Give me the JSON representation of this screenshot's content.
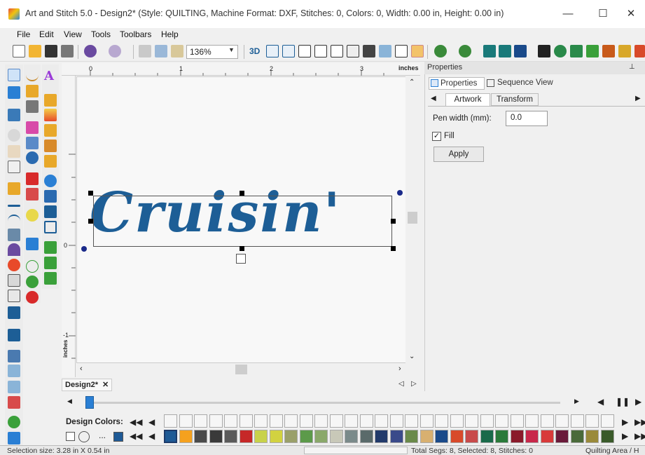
{
  "window": {
    "title": "Art and Stitch 5.0 - Design2* (Style: QUILTING, Machine Format: DXF, Stitches: 0, Colors: 0, Width: 0.00 in, Height: 0.00 in)",
    "minimize": "—",
    "maximize": "☐",
    "close": "✕"
  },
  "menu": {
    "file": "File",
    "edit": "Edit",
    "view": "View",
    "tools": "Tools",
    "toolbars": "Toolbars",
    "help": "Help"
  },
  "toolbar": {
    "zoom_value": "136%",
    "view3d_label": "3D"
  },
  "ruler": {
    "units": "inches",
    "side_units": "inches",
    "top_ticks": [
      "0",
      "1",
      "2",
      "3"
    ],
    "left_ticks": [
      "0",
      "-1"
    ]
  },
  "canvas": {
    "artwork_text": "Cruisin'"
  },
  "doc_tab": {
    "label": "Design2*",
    "close": "✕"
  },
  "properties": {
    "header": "Properties",
    "pin": "ᵖ",
    "tab_properties": "Properties",
    "tab_sequence": "Sequence View",
    "subtab_artwork": "Artwork",
    "subtab_transform": "Transform",
    "pen_width_label": "Pen width (mm):",
    "pen_width_value": "0.0",
    "fill_label": "Fill",
    "fill_checked": true,
    "apply_label": "Apply"
  },
  "design_colors": {
    "label": "Design Colors:",
    "dots": "...",
    "palette": [
      "#1e5a96",
      "#f5a11e",
      "#4a4a4a",
      "#3a3a3a",
      "#5a5a5a",
      "#c62828",
      "#c8d24a",
      "#d2d240",
      "#9aa06a",
      "#5c9a4a",
      "#8aa86a",
      "#c8c8b8",
      "#7a8a8a",
      "#5a6a6a",
      "#223a6a",
      "#3a4a8a",
      "#6a8a4a",
      "#d8b070",
      "#1a4a8a",
      "#d84a2a",
      "#c84a4a",
      "#1a6a4a",
      "#2a7a3a",
      "#8a1a2a",
      "#c8284a",
      "#d83a3a",
      "#6a1a3a",
      "#4a6a3a",
      "#9a8a3a",
      "#3a5a2a"
    ]
  },
  "status": {
    "selection_size": "Selection size: 3.28 in X 0.54 in",
    "total_segs": "Total Segs: 8, Selected: 8, Stitches: 0",
    "quilting_area": "Quilting Area / H"
  },
  "colors": {
    "brand": "#1d5e96",
    "accent": "#2a7fd4"
  }
}
